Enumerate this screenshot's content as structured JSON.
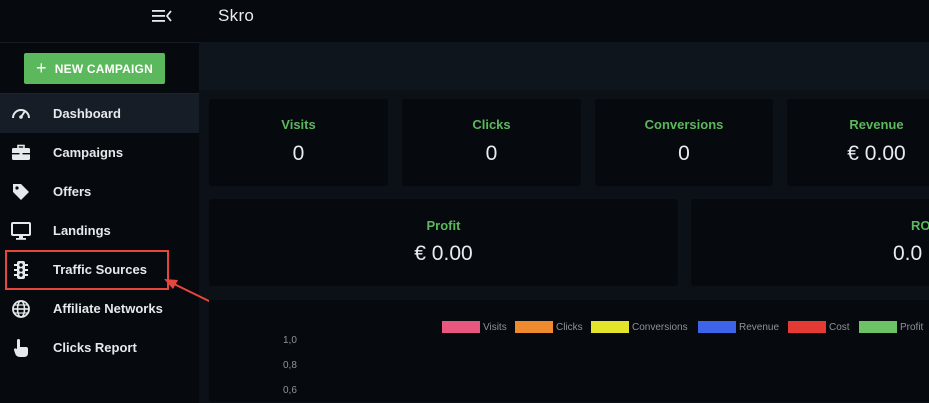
{
  "header": {
    "title": "Skro"
  },
  "sidebar": {
    "new_campaign_label": "NEW CAMPAIGN",
    "items": [
      {
        "label": "Dashboard",
        "icon": "gauge-icon",
        "active": true
      },
      {
        "label": "Campaigns",
        "icon": "briefcase-icon"
      },
      {
        "label": "Offers",
        "icon": "tag-icon"
      },
      {
        "label": "Landings",
        "icon": "monitor-icon"
      },
      {
        "label": "Traffic Sources",
        "icon": "traffic-light-icon"
      },
      {
        "label": "Affiliate Networks",
        "icon": "globe-icon"
      },
      {
        "label": "Clicks Report",
        "icon": "pointer-hand-icon"
      }
    ]
  },
  "stats": {
    "visits": {
      "label": "Visits",
      "value": "0"
    },
    "clicks": {
      "label": "Clicks",
      "value": "0"
    },
    "conversions": {
      "label": "Conversions",
      "value": "0"
    },
    "revenue": {
      "label": "Revenue",
      "value": "€ 0.00"
    },
    "profit": {
      "label": "Profit",
      "value": "€ 0.00"
    },
    "roi": {
      "label": "RO",
      "value": "0.0"
    }
  },
  "chart_data": {
    "type": "line",
    "series": [
      {
        "name": "Visits",
        "color": "#e8577e",
        "values": []
      },
      {
        "name": "Clicks",
        "color": "#ef8a2e",
        "values": []
      },
      {
        "name": "Conversions",
        "color": "#e4e42a",
        "values": []
      },
      {
        "name": "Revenue",
        "color": "#3d64e8",
        "values": []
      },
      {
        "name": "Cost",
        "color": "#e33a33",
        "values": []
      },
      {
        "name": "Profit",
        "color": "#6cc265",
        "values": []
      }
    ],
    "y_ticks": [
      "1,0",
      "0,8",
      "0,6"
    ],
    "legend_position": "top-right"
  },
  "colors": {
    "accent": "#5cb85c",
    "highlight": "#e8453c"
  }
}
